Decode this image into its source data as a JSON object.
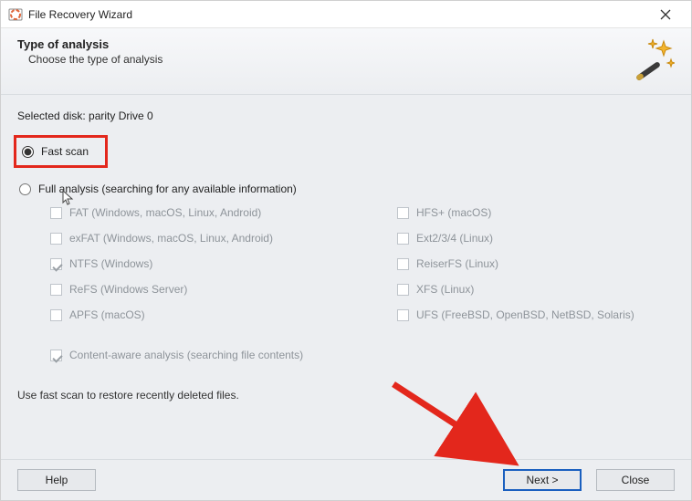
{
  "window": {
    "title": "File Recovery Wizard"
  },
  "header": {
    "heading": "Type of analysis",
    "sub": "Choose the type of analysis"
  },
  "selectedDiskLabel": "Selected disk: parity Drive 0",
  "options": {
    "fastScan": "Fast scan",
    "fullAnalysis": "Full analysis (searching for any available information)"
  },
  "filesystems": {
    "left": [
      "FAT (Windows, macOS, Linux, Android)",
      "exFAT (Windows, macOS, Linux, Android)",
      "NTFS (Windows)",
      "ReFS (Windows Server)",
      "APFS (macOS)"
    ],
    "right": [
      "HFS+ (macOS)",
      "Ext2/3/4 (Linux)",
      "ReiserFS (Linux)",
      "XFS (Linux)",
      "UFS (FreeBSD, OpenBSD, NetBSD, Solaris)"
    ]
  },
  "contentAware": "Content-aware analysis (searching file contents)",
  "hint": "Use fast scan to restore recently deleted files.",
  "buttons": {
    "help": "Help",
    "next": "Next >",
    "close": "Close"
  }
}
